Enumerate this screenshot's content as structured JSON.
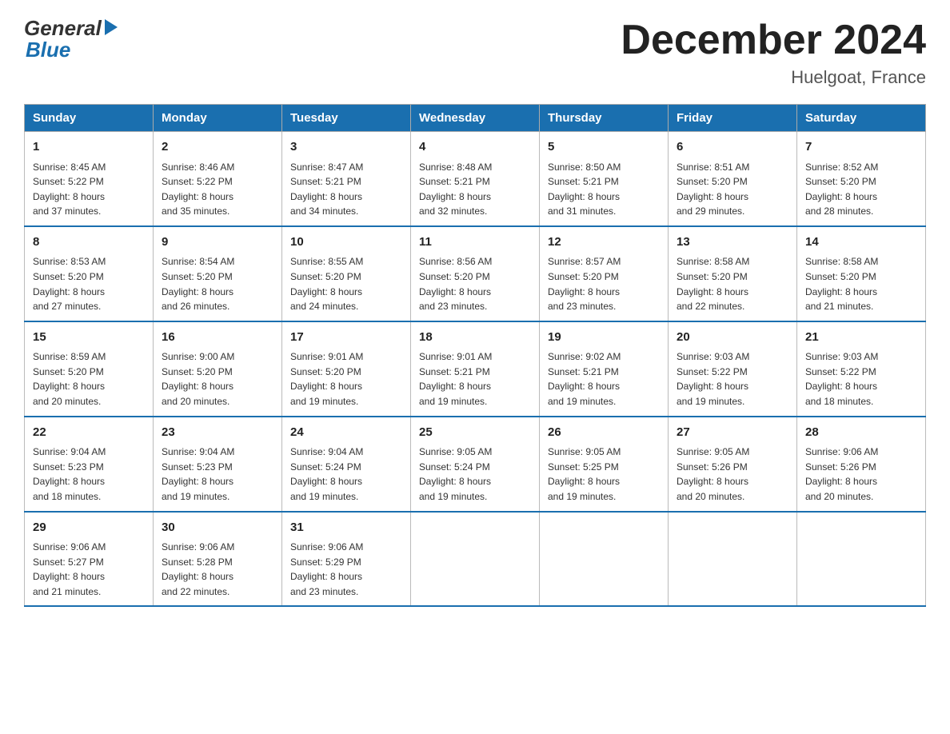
{
  "header": {
    "logo_general": "General",
    "logo_blue": "Blue",
    "month_title": "December 2024",
    "location": "Huelgoat, France"
  },
  "weekdays": [
    "Sunday",
    "Monday",
    "Tuesday",
    "Wednesday",
    "Thursday",
    "Friday",
    "Saturday"
  ],
  "weeks": [
    [
      {
        "day": "1",
        "sunrise": "8:45 AM",
        "sunset": "5:22 PM",
        "daylight": "8 hours and 37 minutes."
      },
      {
        "day": "2",
        "sunrise": "8:46 AM",
        "sunset": "5:22 PM",
        "daylight": "8 hours and 35 minutes."
      },
      {
        "day": "3",
        "sunrise": "8:47 AM",
        "sunset": "5:21 PM",
        "daylight": "8 hours and 34 minutes."
      },
      {
        "day": "4",
        "sunrise": "8:48 AM",
        "sunset": "5:21 PM",
        "daylight": "8 hours and 32 minutes."
      },
      {
        "day": "5",
        "sunrise": "8:50 AM",
        "sunset": "5:21 PM",
        "daylight": "8 hours and 31 minutes."
      },
      {
        "day": "6",
        "sunrise": "8:51 AM",
        "sunset": "5:20 PM",
        "daylight": "8 hours and 29 minutes."
      },
      {
        "day": "7",
        "sunrise": "8:52 AM",
        "sunset": "5:20 PM",
        "daylight": "8 hours and 28 minutes."
      }
    ],
    [
      {
        "day": "8",
        "sunrise": "8:53 AM",
        "sunset": "5:20 PM",
        "daylight": "8 hours and 27 minutes."
      },
      {
        "day": "9",
        "sunrise": "8:54 AM",
        "sunset": "5:20 PM",
        "daylight": "8 hours and 26 minutes."
      },
      {
        "day": "10",
        "sunrise": "8:55 AM",
        "sunset": "5:20 PM",
        "daylight": "8 hours and 24 minutes."
      },
      {
        "day": "11",
        "sunrise": "8:56 AM",
        "sunset": "5:20 PM",
        "daylight": "8 hours and 23 minutes."
      },
      {
        "day": "12",
        "sunrise": "8:57 AM",
        "sunset": "5:20 PM",
        "daylight": "8 hours and 23 minutes."
      },
      {
        "day": "13",
        "sunrise": "8:58 AM",
        "sunset": "5:20 PM",
        "daylight": "8 hours and 22 minutes."
      },
      {
        "day": "14",
        "sunrise": "8:58 AM",
        "sunset": "5:20 PM",
        "daylight": "8 hours and 21 minutes."
      }
    ],
    [
      {
        "day": "15",
        "sunrise": "8:59 AM",
        "sunset": "5:20 PM",
        "daylight": "8 hours and 20 minutes."
      },
      {
        "day": "16",
        "sunrise": "9:00 AM",
        "sunset": "5:20 PM",
        "daylight": "8 hours and 20 minutes."
      },
      {
        "day": "17",
        "sunrise": "9:01 AM",
        "sunset": "5:20 PM",
        "daylight": "8 hours and 19 minutes."
      },
      {
        "day": "18",
        "sunrise": "9:01 AM",
        "sunset": "5:21 PM",
        "daylight": "8 hours and 19 minutes."
      },
      {
        "day": "19",
        "sunrise": "9:02 AM",
        "sunset": "5:21 PM",
        "daylight": "8 hours and 19 minutes."
      },
      {
        "day": "20",
        "sunrise": "9:03 AM",
        "sunset": "5:22 PM",
        "daylight": "8 hours and 19 minutes."
      },
      {
        "day": "21",
        "sunrise": "9:03 AM",
        "sunset": "5:22 PM",
        "daylight": "8 hours and 18 minutes."
      }
    ],
    [
      {
        "day": "22",
        "sunrise": "9:04 AM",
        "sunset": "5:23 PM",
        "daylight": "8 hours and 18 minutes."
      },
      {
        "day": "23",
        "sunrise": "9:04 AM",
        "sunset": "5:23 PM",
        "daylight": "8 hours and 19 minutes."
      },
      {
        "day": "24",
        "sunrise": "9:04 AM",
        "sunset": "5:24 PM",
        "daylight": "8 hours and 19 minutes."
      },
      {
        "day": "25",
        "sunrise": "9:05 AM",
        "sunset": "5:24 PM",
        "daylight": "8 hours and 19 minutes."
      },
      {
        "day": "26",
        "sunrise": "9:05 AM",
        "sunset": "5:25 PM",
        "daylight": "8 hours and 19 minutes."
      },
      {
        "day": "27",
        "sunrise": "9:05 AM",
        "sunset": "5:26 PM",
        "daylight": "8 hours and 20 minutes."
      },
      {
        "day": "28",
        "sunrise": "9:06 AM",
        "sunset": "5:26 PM",
        "daylight": "8 hours and 20 minutes."
      }
    ],
    [
      {
        "day": "29",
        "sunrise": "9:06 AM",
        "sunset": "5:27 PM",
        "daylight": "8 hours and 21 minutes."
      },
      {
        "day": "30",
        "sunrise": "9:06 AM",
        "sunset": "5:28 PM",
        "daylight": "8 hours and 22 minutes."
      },
      {
        "day": "31",
        "sunrise": "9:06 AM",
        "sunset": "5:29 PM",
        "daylight": "8 hours and 23 minutes."
      },
      null,
      null,
      null,
      null
    ]
  ],
  "labels": {
    "sunrise": "Sunrise:",
    "sunset": "Sunset:",
    "daylight": "Daylight:"
  }
}
